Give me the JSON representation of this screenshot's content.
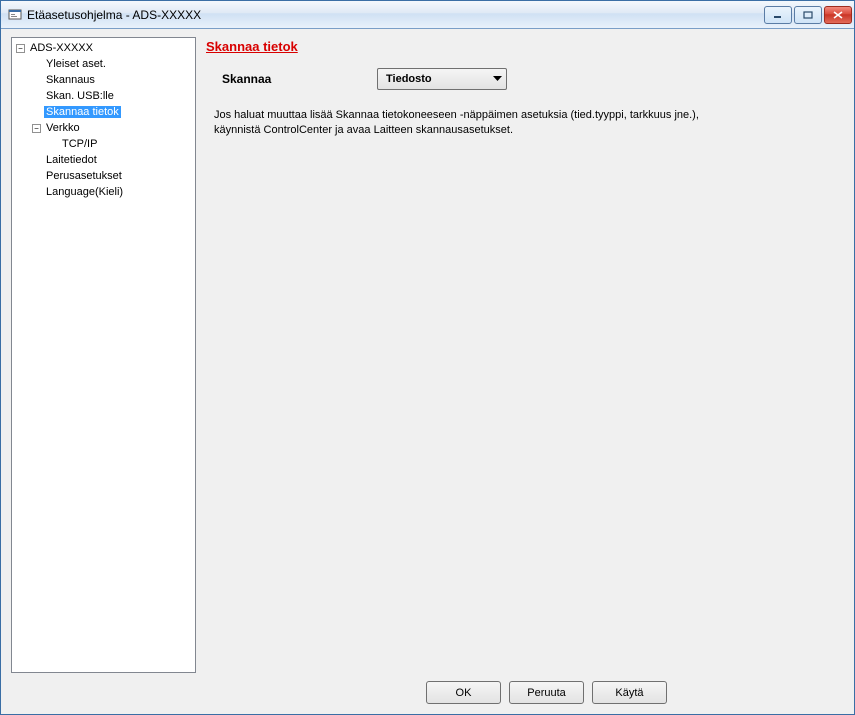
{
  "window": {
    "title": "Etäasetusohjelma - ADS-XXXXX"
  },
  "tree": {
    "root": "ADS-XXXXX",
    "items": {
      "yleisetAset": "Yleiset aset.",
      "skannaus": "Skannaus",
      "skanUsb": "Skan. USB:lle",
      "skannaaTietok": "Skannaa tietok",
      "verkko": "Verkko",
      "tcpip": "TCP/IP",
      "laitetiedot": "Laitetiedot",
      "perusasetukset": "Perusasetukset",
      "language": "Language(Kieli)"
    }
  },
  "panel": {
    "title": "Skannaa tietok",
    "fieldLabel": "Skannaa",
    "selectValue": "Tiedosto",
    "helpText1": "Jos haluat muuttaa lisää Skannaa tietokoneeseen -näppäimen asetuksia (tied.tyyppi, tarkkuus jne.),",
    "helpText2": "käynnistä ControlCenter ja avaa Laitteen skannausasetukset."
  },
  "buttons": {
    "ok": "OK",
    "cancel": "Peruuta",
    "apply": "Käytä"
  }
}
